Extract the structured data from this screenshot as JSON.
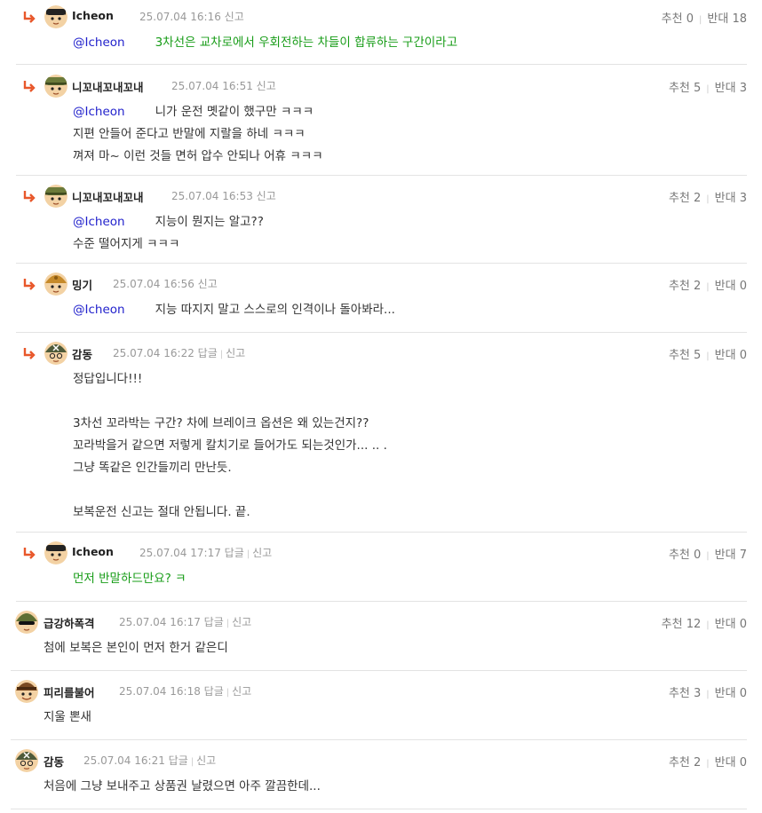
{
  "comments": [
    {
      "nick": "Icheon",
      "time": "25.07.04 16:16",
      "actions": [
        "신고"
      ],
      "up_label": "추천",
      "up": "0",
      "down_label": "반대",
      "down": "18",
      "mention": "@Icheon",
      "lines": [
        "3차선은 교차로에서 우회전하는 차들이 합류하는 구간이라고"
      ],
      "green": true
    },
    {
      "nick": "니꼬내꼬내꼬내",
      "time": "25.07.04 16:51",
      "actions": [
        "신고"
      ],
      "up_label": "추천",
      "up": "5",
      "down_label": "반대",
      "down": "3",
      "mention": "@Icheon",
      "lines": [
        "니가 운전 몟같이 했구만 ㅋㅋㅋ",
        "지편 안들어 준다고 반말에 지랄을 하네 ㅋㅋㅋ",
        "껴져 마~ 이런 것들 면허 압수 안되나 어휴 ㅋㅋㅋ"
      ]
    },
    {
      "nick": "니꼬내꼬내꼬내",
      "time": "25.07.04 16:53",
      "actions": [
        "신고"
      ],
      "up_label": "추천",
      "up": "2",
      "down_label": "반대",
      "down": "3",
      "mention": "@Icheon",
      "lines": [
        "지능이 뭔지는 알고??",
        "수준 떨어지게 ㅋㅋㅋ"
      ]
    },
    {
      "nick": "밍기",
      "time": "25.07.04 16:56",
      "actions": [
        "신고"
      ],
      "up_label": "추천",
      "up": "2",
      "down_label": "반대",
      "down": "0",
      "mention": "@Icheon",
      "lines": [
        "지능 따지지 말고 스스로의 인격이나 돌아봐라..."
      ]
    },
    {
      "nick": "감동",
      "time": "25.07.04 16:22",
      "actions": [
        "답글",
        "신고"
      ],
      "up_label": "추천",
      "up": "5",
      "down_label": "반대",
      "down": "0",
      "lines": [
        "정답입니다!!!",
        "",
        "3차선 꼬라박는 구간? 차에 브레이크 옵션은 왜 있는건지??",
        "꼬라박을거 같으면 저렇게 칼치기로 들어가도 되는것인가... .. .",
        "그냥 똑같은 인간들끼리 만난듯.",
        "",
        "보복운전 신고는 절대 안됩니다. 끝."
      ]
    },
    {
      "nick": "Icheon",
      "time": "25.07.04 17:17",
      "actions": [
        "답글",
        "신고"
      ],
      "up_label": "추천",
      "up": "0",
      "down_label": "반대",
      "down": "7",
      "lines": [
        "먼저 반말하드만요? ㅋ"
      ],
      "green": true
    },
    {
      "nick": "급강하폭격",
      "time": "25.07.04 16:17",
      "actions": [
        "답글",
        "신고"
      ],
      "up_label": "추천",
      "up": "12",
      "down_label": "반대",
      "down": "0",
      "lines": [
        "첨에 보복은 본인이 먼저 한거 같은디"
      ]
    },
    {
      "nick": "피리를불어",
      "time": "25.07.04 16:18",
      "actions": [
        "답글",
        "신고"
      ],
      "up_label": "추천",
      "up": "3",
      "down_label": "반대",
      "down": "0",
      "lines": [
        "지울 뽄새"
      ]
    },
    {
      "nick": "감동",
      "time": "25.07.04 16:21",
      "actions": [
        "답글",
        "신고"
      ],
      "up_label": "추천",
      "up": "2",
      "down_label": "반대",
      "down": "0",
      "lines": [
        "처음에 그냥 보내주고 상품권 날렸으면 아주 깔끔한데..."
      ]
    }
  ],
  "colors": {
    "mention": "#2222cc",
    "green_text": "#179c17",
    "reply_arrow": "#e8572a",
    "divider": "#e3e3e3"
  },
  "icons": {
    "reply": "reply-arrow-icon",
    "avatar": "avatar-icon"
  }
}
